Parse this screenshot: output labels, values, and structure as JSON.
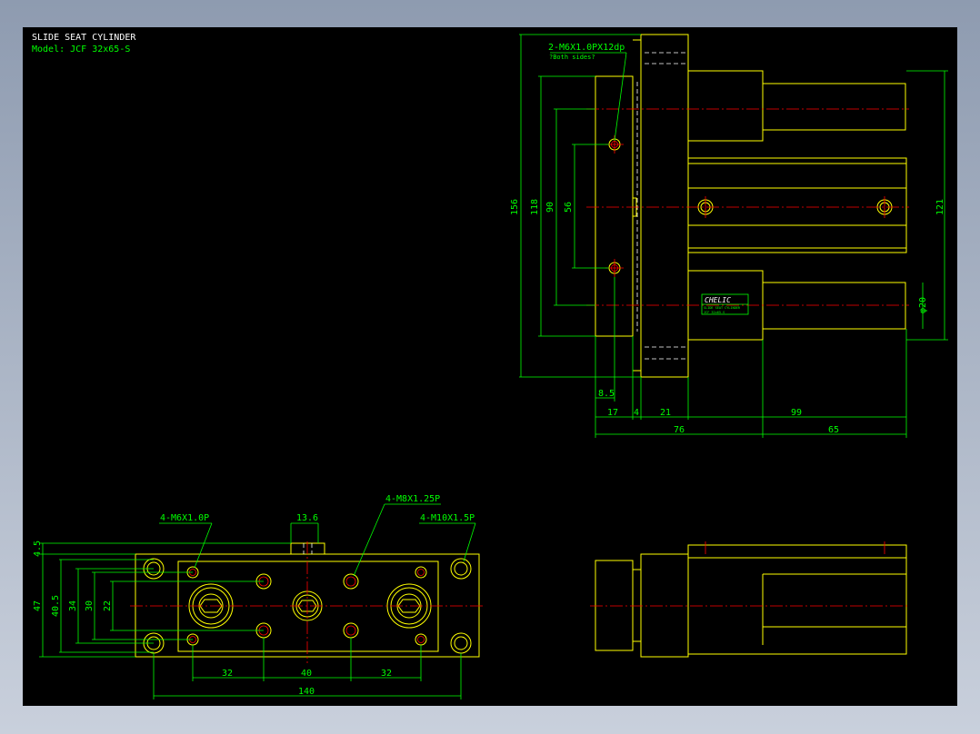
{
  "header": {
    "title": "SLIDE SEAT CYLINDER",
    "model": "Model: JCF 32x65-S"
  },
  "colors": {
    "background": "#000000",
    "outline": "#ffff00",
    "dimension": "#00ff00",
    "centerline": "#ff0000",
    "hidden": "#ffffff"
  },
  "callouts": {
    "top_tap": "2-M6X1.0PX12dp",
    "top_tap_sub": "?Both sides?",
    "bottom_m6": "4-M6X1.0P",
    "bottom_m8": "4-M8X1.25P",
    "bottom_m10": "4-M10X1.5P",
    "brand": "CHELIC",
    "label_line1": "SLIDE SEAT CYLINDER",
    "label_line2": "JCF 32x65-S"
  },
  "dims_top": {
    "d156": "156",
    "d118": "118",
    "d90": "90",
    "d56": "56",
    "d121": "121",
    "phi20": "φ20",
    "d8_5": "8.5",
    "d17": "17",
    "d4": "4",
    "d21": "21",
    "d99": "99",
    "d76": "76",
    "d65": "65"
  },
  "dims_bottom": {
    "d13_6": "13.6",
    "d4_5": "4.5",
    "d47": "47",
    "d40_5": "40.5",
    "d34": "34",
    "d30": "30",
    "d22": "22",
    "d32a": "32",
    "d40": "40",
    "d32b": "32",
    "d140": "140"
  }
}
